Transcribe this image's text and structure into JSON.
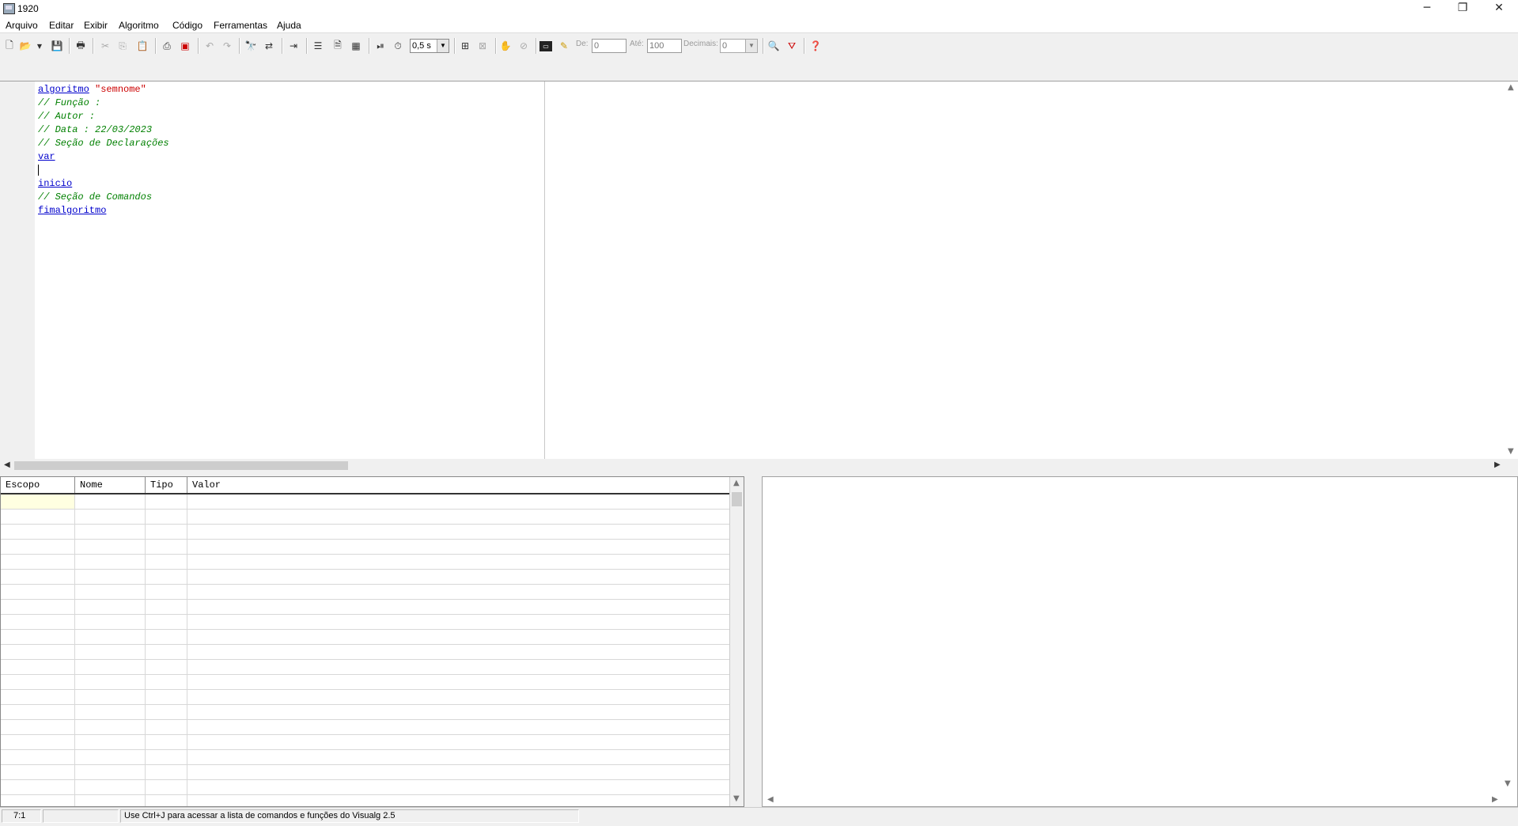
{
  "window": {
    "title": "1920",
    "minimize": "─",
    "restore": "❐",
    "close": "✕"
  },
  "menu": [
    "Arquivo",
    "Editar",
    "Exibir",
    "Algoritmo",
    "Código",
    "Ferramentas",
    "Ajuda"
  ],
  "toolbar": {
    "delay_value": "0,5 s",
    "de_label": "De:",
    "de_value": "0",
    "ate_label": "Até:",
    "ate_value": "100",
    "decimais_label": "Decimais:",
    "decimais_value": "0"
  },
  "editor": {
    "lines": [
      {
        "kw": "algoritmo",
        "str": "\"semnome\""
      },
      {
        "cm": "// Função :"
      },
      {
        "cm": "// Autor :"
      },
      {
        "cm": "// Data : 22/03/2023"
      },
      {
        "cm": "// Seção de Declarações"
      },
      {
        "kw": "var"
      },
      {
        "caret": true
      },
      {
        "kw": "inicio"
      },
      {
        "cm": "// Seção de Comandos"
      },
      {
        "kw": "fimalgoritmo"
      }
    ]
  },
  "grid": {
    "columns": [
      "Escopo",
      "Nome",
      "Tipo",
      "Valor"
    ]
  },
  "status": {
    "cursor_pos": "7:1",
    "hint": "Use Ctrl+J para acessar a lista de comandos e funções do Visualg 2.5"
  }
}
